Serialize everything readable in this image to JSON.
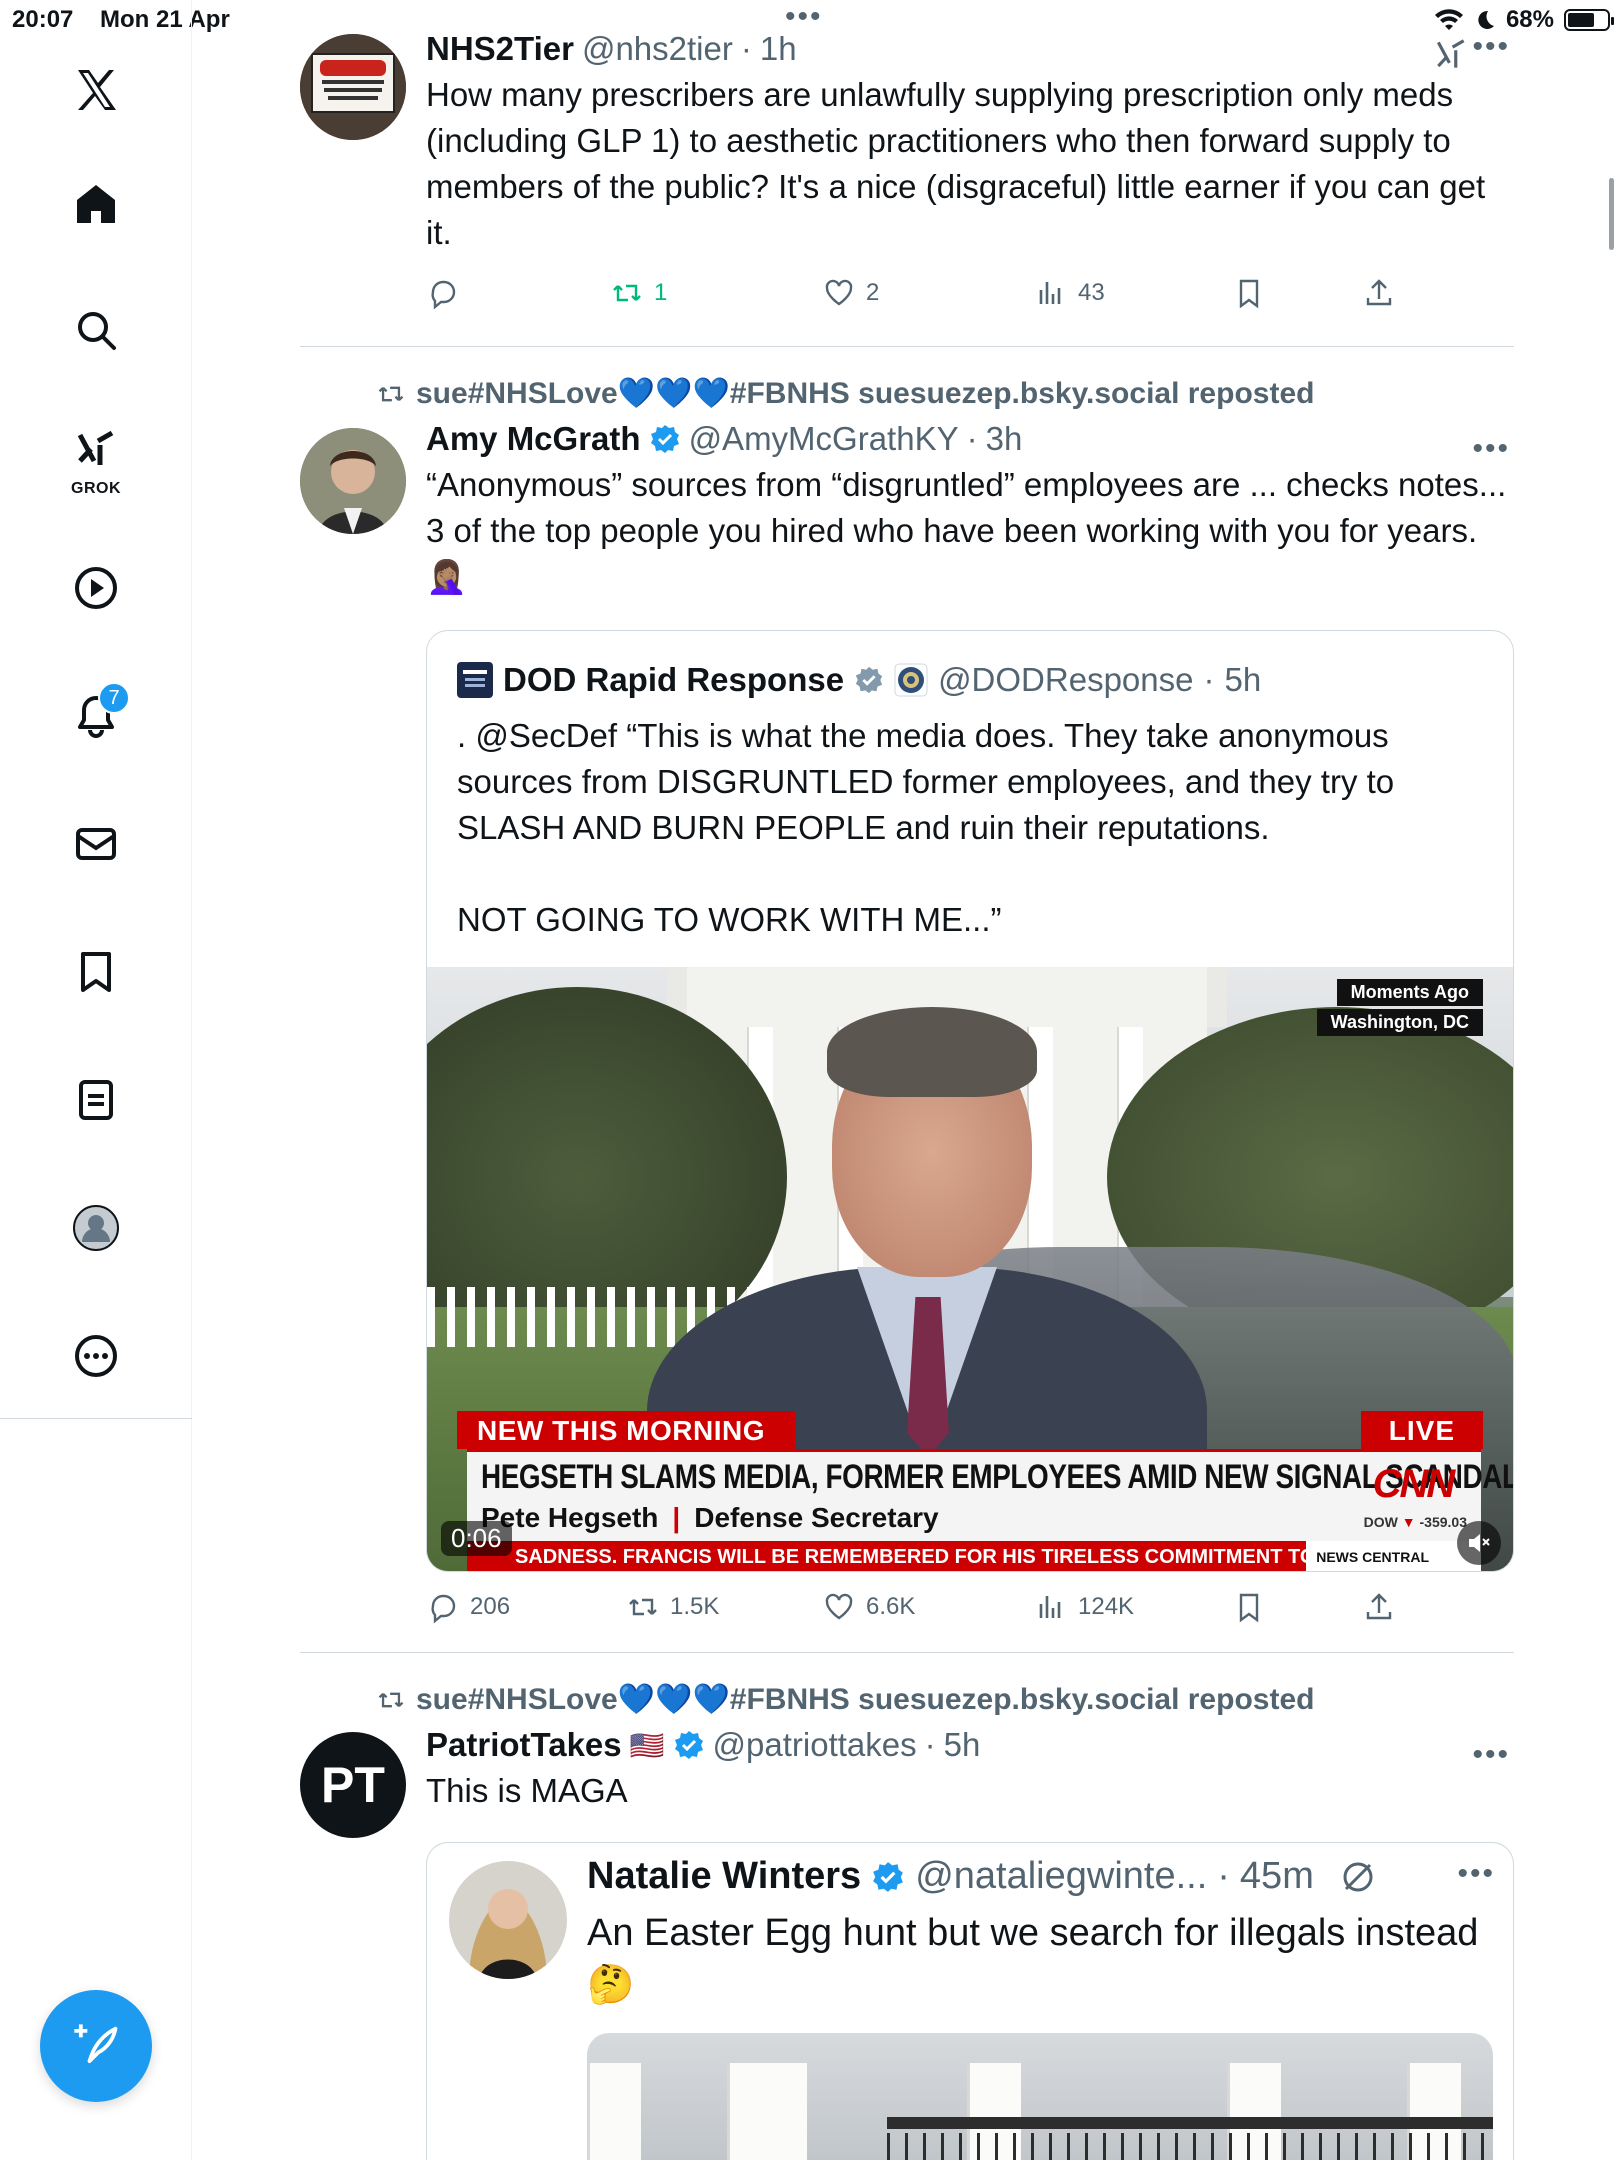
{
  "status_bar": {
    "time": "20:07",
    "date": "Mon 21 Apr",
    "battery": "68%",
    "battery_level": 0.68
  },
  "sidebar": {
    "items": [
      {
        "name": "home",
        "icon": "home-icon"
      },
      {
        "name": "explore",
        "icon": "search-icon"
      },
      {
        "name": "grok",
        "icon": "grok-icon",
        "label": "GROK"
      },
      {
        "name": "video",
        "icon": "play-icon"
      },
      {
        "name": "notifications",
        "icon": "bell-icon",
        "badge": "7"
      },
      {
        "name": "messages",
        "icon": "mail-icon"
      },
      {
        "name": "bookmarks",
        "icon": "bookmark-icon"
      },
      {
        "name": "lists",
        "icon": "list-icon"
      },
      {
        "name": "profile",
        "icon": "profile-icon"
      },
      {
        "name": "more",
        "icon": "more-icon"
      }
    ],
    "compose_icon": "compose-icon"
  },
  "feed": {
    "tweet1": {
      "name": "NHS2Tier",
      "handle": "@nhs2tier",
      "time": "1h",
      "text": "How many prescribers are unlawfully supplying prescription only meds (including GLP 1) to aesthetic practitioners who then forward supply to members of the public? It's a nice (disgraceful) little earner if you can get it.",
      "replies": "",
      "reposts": "1",
      "likes": "2",
      "views": "43"
    },
    "tweet2": {
      "reposted_by": "sue#NHSLove💙💙💙#FBNHS suesuezep.bsky.social reposted",
      "name": "Amy McGrath",
      "handle": "@AmyMcGrathKY",
      "time": "3h",
      "text": "“Anonymous” sources from “disgruntled” employees are ... checks notes... 3 of the top people you hired who have been working with you for years. 🤦🏽‍♀️",
      "quote": {
        "name": "DOD Rapid Response",
        "handle": "@DODResponse",
        "time": "5h",
        "text": ". @SecDef “This is what the media does. They take anonymous sources from DISGRUNTLED former employees, and they try to SLASH AND BURN PEOPLE and ruin their reputations.\n\nNOT GOING TO WORK WITH ME...”",
        "video": {
          "tag_line1": "Moments Ago",
          "tag_line2": "Washington, DC",
          "chyron_top": "NEW THIS MORNING",
          "live": "LIVE",
          "headline": "HEGSETH SLAMS MEDIA, FORMER EMPLOYEES AMID NEW SIGNAL SCANDAL",
          "subject_name": "Pete Hegseth",
          "subject_title": "Defense Secretary",
          "network": "CNN",
          "dow_label": "DOW",
          "dow_value": "-359.03",
          "ticker": "SADNESS. FRANCIS WILL BE REMEMBERED FOR HIS TIRELESS COMMITMENT TO TH",
          "ticker_tag": "NEWS CENTRAL",
          "time": "0:06"
        }
      },
      "replies": "206",
      "reposts": "1.5K",
      "likes": "6.6K",
      "views": "124K"
    },
    "tweet3": {
      "reposted_by": "sue#NHSLove💙💙💙#FBNHS suesuezep.bsky.social reposted",
      "name": "PatriotTakes",
      "flag": "🇺🇸",
      "handle": "@patriottakes",
      "time": "5h",
      "avatar_text": "PT",
      "text": "This is MAGA",
      "quote": {
        "name": "Natalie Winters",
        "handle": "@nataliegwinte...",
        "time": "45m",
        "text": "An Easter Egg hunt but we search for illegals instead 🤔"
      }
    }
  },
  "colors": {
    "accent": "#1d9bf0",
    "text": "#0f1419",
    "muted": "#536471",
    "repost_green": "#00ba7c",
    "cnn_red": "#cc0000"
  }
}
